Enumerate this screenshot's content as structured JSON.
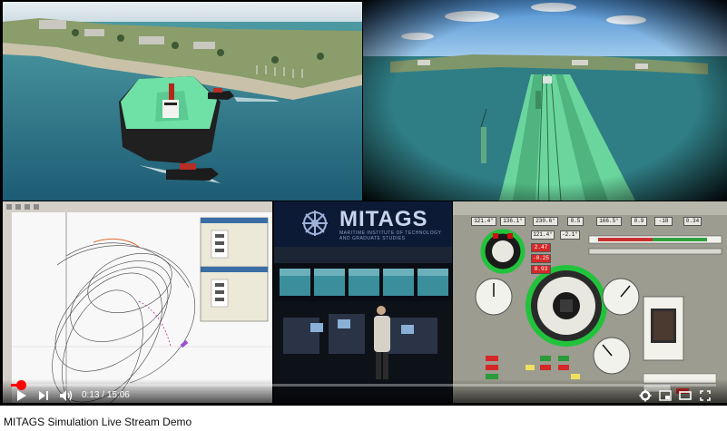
{
  "video": {
    "title": "MITAGS Simulation Live Stream Demo",
    "current_time": "0:13",
    "separator": " / ",
    "duration": "15:06",
    "progress_fraction": 0.0143
  },
  "logo": {
    "name": "MITAGS",
    "subtitle": "MARITIME INSTITUTE OF TECHNOLOGY AND GRADUATE STUDIES"
  },
  "console": {
    "header_readouts": [
      "121.4°",
      "136.1°",
      "230.6°",
      "0.5",
      "166.5°",
      "0.9",
      "-18",
      "0.34"
    ],
    "side_readouts": [
      "121.4°",
      "-2.1°",
      "2.47",
      "-0.25",
      "0.93"
    ]
  },
  "icons": {
    "play": "play-icon",
    "next": "next-icon",
    "volume": "volume-icon",
    "settings": "gear-icon",
    "miniplayer": "miniplayer-icon",
    "theater": "theater-icon",
    "fullscreen": "fullscreen-icon"
  },
  "colors": {
    "progress": "#ff0000",
    "hull_green": "#6fe0a6"
  }
}
